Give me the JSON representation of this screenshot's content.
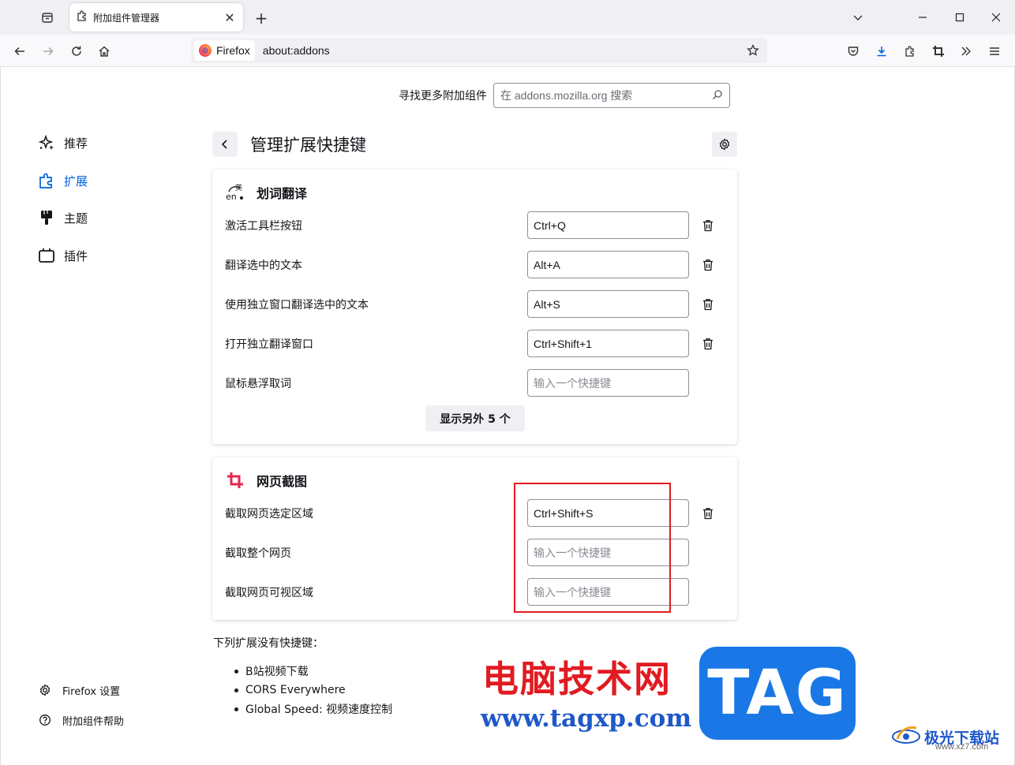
{
  "browser": {
    "tab_title": "附加组件管理器",
    "identity_label": "Firefox",
    "url": "about:addons"
  },
  "sidebar": {
    "items": [
      {
        "label": "推荐",
        "icon": "sparkle-icon",
        "active": false
      },
      {
        "label": "扩展",
        "icon": "puzzle-icon",
        "active": true
      },
      {
        "label": "主题",
        "icon": "brush-icon",
        "active": false
      },
      {
        "label": "插件",
        "icon": "plugin-icon",
        "active": false
      }
    ],
    "footer": {
      "settings": "Firefox 设置",
      "help": "附加组件帮助"
    }
  },
  "search": {
    "label": "寻找更多附加组件",
    "placeholder": "在 addons.mozilla.org 搜索"
  },
  "header": {
    "title": "管理扩展快捷键"
  },
  "extensions": [
    {
      "name": "划词翻译",
      "shortcuts": [
        {
          "label": "激活工具栏按钮",
          "value": "Ctrl+Q"
        },
        {
          "label": "翻译选中的文本",
          "value": "Alt+A"
        },
        {
          "label": "使用独立窗口翻译选中的文本",
          "value": "Alt+S"
        },
        {
          "label": "打开独立翻译窗口",
          "value": "Ctrl+Shift+1"
        },
        {
          "label": "鼠标悬浮取词",
          "value": ""
        }
      ],
      "more_label": "显示另外 5 个"
    },
    {
      "name": "网页截图",
      "shortcuts": [
        {
          "label": "截取网页选定区域",
          "value": "Ctrl+Shift+S"
        },
        {
          "label": "截取整个网页",
          "value": ""
        },
        {
          "label": "截取网页可视区域",
          "value": ""
        }
      ]
    }
  ],
  "shortcut_placeholder": "输入一个快捷键",
  "no_shortcuts": {
    "title": "下列扩展没有快捷键：",
    "items": [
      "B站视频下载",
      "CORS Everywhere",
      "Global Speed: 视频速度控制"
    ]
  },
  "watermark": {
    "cn": "电脑技术网",
    "url": "www.tagxp.com",
    "tag": "TAG",
    "site_name": "极光下载站",
    "site_url": "www.xz7.com"
  },
  "colors": {
    "accent": "#0061e0",
    "highlight_box": "#e11b22",
    "screenshot_icon": "#e22850"
  }
}
